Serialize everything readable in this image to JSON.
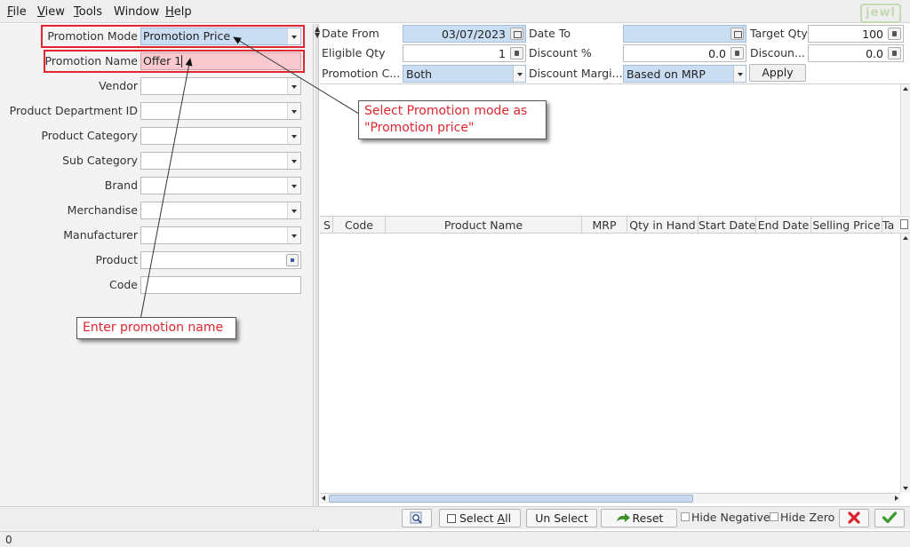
{
  "menubar": {
    "items": [
      {
        "label_underlined": "F",
        "label_rest": "ile"
      },
      {
        "label_underlined": "V",
        "label_rest": "iew"
      },
      {
        "label_underlined": "T",
        "label_rest": "ools"
      },
      {
        "label_underlined": "",
        "label_rest": "Window"
      },
      {
        "label_underlined": "H",
        "label_rest": "elp"
      }
    ],
    "logo_text": "jewl"
  },
  "left_form": {
    "promotion_mode": {
      "label": "Promotion Mode",
      "value": "Promotion Price"
    },
    "promotion_name": {
      "label": "Promotion Name",
      "value": "Offer 1"
    },
    "vendor": {
      "label": "Vendor",
      "value": ""
    },
    "product_department_id": {
      "label": "Product Department ID",
      "value": ""
    },
    "product_category": {
      "label": "Product Category",
      "value": ""
    },
    "sub_category": {
      "label": "Sub Category",
      "value": ""
    },
    "brand": {
      "label": "Brand",
      "value": ""
    },
    "merchandise": {
      "label": "Merchandise",
      "value": ""
    },
    "manufacturer": {
      "label": "Manufacturer",
      "value": ""
    },
    "product": {
      "label": "Product",
      "value": ""
    },
    "code": {
      "label": "Code",
      "value": ""
    }
  },
  "top_form": {
    "date_from": {
      "label": "Date From",
      "value": "03/07/2023"
    },
    "date_to": {
      "label": "Date To",
      "value": ""
    },
    "target_qty": {
      "label": "Target Qty",
      "value": "100"
    },
    "eligible_qty": {
      "label": "Eligible Qty",
      "value": "1"
    },
    "discount_pct": {
      "label": "Discount %",
      "value": "0.0"
    },
    "discount_amt": {
      "label": "Discoun...",
      "value": "0.0"
    },
    "promotion_c": {
      "label": "Promotion C...",
      "value": "Both"
    },
    "discount_margin": {
      "label": "Discount Margi...",
      "value": "Based on MRP"
    },
    "apply_label": "Apply"
  },
  "grid": {
    "columns": [
      "S",
      "Code",
      "Product Name",
      "MRP",
      "Qty in Hand",
      "Start Date",
      "End Date",
      "Selling Price",
      "Ta"
    ],
    "rows": []
  },
  "toolbar": {
    "select_all_u": "A",
    "select_all_pre": "Select ",
    "select_all_post": "ll",
    "unselect_label": "Un Select",
    "reset_label": "Reset",
    "hide_negative_label": "Hide Negative",
    "hide_zero_label": "Hide Zero"
  },
  "status": {
    "text": "0"
  },
  "annotations": {
    "callout_mode": [
      "Select Promotion mode as",
      "\"Promotion price\""
    ],
    "callout_name": "Enter promotion name",
    "highlight_color": "#e0262e"
  },
  "colors": {
    "date_field_bg": "#c9def2",
    "name_field_bg": "#f8c9cf",
    "cancel_red": "#d8202a",
    "ok_green": "#3a9a2a"
  }
}
